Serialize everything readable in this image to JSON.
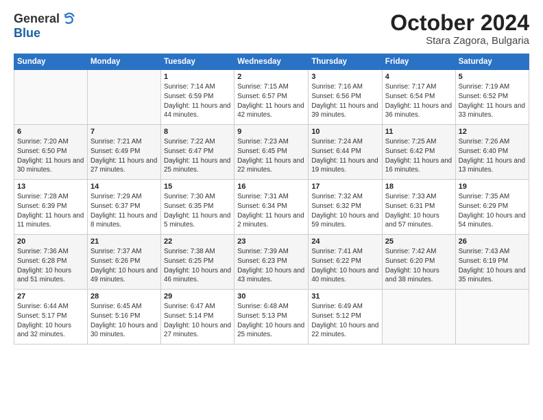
{
  "header": {
    "logo_general": "General",
    "logo_blue": "Blue",
    "month_title": "October 2024",
    "location": "Stara Zagora, Bulgaria"
  },
  "weekdays": [
    "Sunday",
    "Monday",
    "Tuesday",
    "Wednesday",
    "Thursday",
    "Friday",
    "Saturday"
  ],
  "weeks": [
    [
      {
        "day": "",
        "info": ""
      },
      {
        "day": "",
        "info": ""
      },
      {
        "day": "1",
        "info": "Sunrise: 7:14 AM\nSunset: 6:59 PM\nDaylight: 11 hours and 44 minutes."
      },
      {
        "day": "2",
        "info": "Sunrise: 7:15 AM\nSunset: 6:57 PM\nDaylight: 11 hours and 42 minutes."
      },
      {
        "day": "3",
        "info": "Sunrise: 7:16 AM\nSunset: 6:56 PM\nDaylight: 11 hours and 39 minutes."
      },
      {
        "day": "4",
        "info": "Sunrise: 7:17 AM\nSunset: 6:54 PM\nDaylight: 11 hours and 36 minutes."
      },
      {
        "day": "5",
        "info": "Sunrise: 7:19 AM\nSunset: 6:52 PM\nDaylight: 11 hours and 33 minutes."
      }
    ],
    [
      {
        "day": "6",
        "info": "Sunrise: 7:20 AM\nSunset: 6:50 PM\nDaylight: 11 hours and 30 minutes."
      },
      {
        "day": "7",
        "info": "Sunrise: 7:21 AM\nSunset: 6:49 PM\nDaylight: 11 hours and 27 minutes."
      },
      {
        "day": "8",
        "info": "Sunrise: 7:22 AM\nSunset: 6:47 PM\nDaylight: 11 hours and 25 minutes."
      },
      {
        "day": "9",
        "info": "Sunrise: 7:23 AM\nSunset: 6:45 PM\nDaylight: 11 hours and 22 minutes."
      },
      {
        "day": "10",
        "info": "Sunrise: 7:24 AM\nSunset: 6:44 PM\nDaylight: 11 hours and 19 minutes."
      },
      {
        "day": "11",
        "info": "Sunrise: 7:25 AM\nSunset: 6:42 PM\nDaylight: 11 hours and 16 minutes."
      },
      {
        "day": "12",
        "info": "Sunrise: 7:26 AM\nSunset: 6:40 PM\nDaylight: 11 hours and 13 minutes."
      }
    ],
    [
      {
        "day": "13",
        "info": "Sunrise: 7:28 AM\nSunset: 6:39 PM\nDaylight: 11 hours and 11 minutes."
      },
      {
        "day": "14",
        "info": "Sunrise: 7:29 AM\nSunset: 6:37 PM\nDaylight: 11 hours and 8 minutes."
      },
      {
        "day": "15",
        "info": "Sunrise: 7:30 AM\nSunset: 6:35 PM\nDaylight: 11 hours and 5 minutes."
      },
      {
        "day": "16",
        "info": "Sunrise: 7:31 AM\nSunset: 6:34 PM\nDaylight: 11 hours and 2 minutes."
      },
      {
        "day": "17",
        "info": "Sunrise: 7:32 AM\nSunset: 6:32 PM\nDaylight: 10 hours and 59 minutes."
      },
      {
        "day": "18",
        "info": "Sunrise: 7:33 AM\nSunset: 6:31 PM\nDaylight: 10 hours and 57 minutes."
      },
      {
        "day": "19",
        "info": "Sunrise: 7:35 AM\nSunset: 6:29 PM\nDaylight: 10 hours and 54 minutes."
      }
    ],
    [
      {
        "day": "20",
        "info": "Sunrise: 7:36 AM\nSunset: 6:28 PM\nDaylight: 10 hours and 51 minutes."
      },
      {
        "day": "21",
        "info": "Sunrise: 7:37 AM\nSunset: 6:26 PM\nDaylight: 10 hours and 49 minutes."
      },
      {
        "day": "22",
        "info": "Sunrise: 7:38 AM\nSunset: 6:25 PM\nDaylight: 10 hours and 46 minutes."
      },
      {
        "day": "23",
        "info": "Sunrise: 7:39 AM\nSunset: 6:23 PM\nDaylight: 10 hours and 43 minutes."
      },
      {
        "day": "24",
        "info": "Sunrise: 7:41 AM\nSunset: 6:22 PM\nDaylight: 10 hours and 40 minutes."
      },
      {
        "day": "25",
        "info": "Sunrise: 7:42 AM\nSunset: 6:20 PM\nDaylight: 10 hours and 38 minutes."
      },
      {
        "day": "26",
        "info": "Sunrise: 7:43 AM\nSunset: 6:19 PM\nDaylight: 10 hours and 35 minutes."
      }
    ],
    [
      {
        "day": "27",
        "info": "Sunrise: 6:44 AM\nSunset: 5:17 PM\nDaylight: 10 hours and 32 minutes."
      },
      {
        "day": "28",
        "info": "Sunrise: 6:45 AM\nSunset: 5:16 PM\nDaylight: 10 hours and 30 minutes."
      },
      {
        "day": "29",
        "info": "Sunrise: 6:47 AM\nSunset: 5:14 PM\nDaylight: 10 hours and 27 minutes."
      },
      {
        "day": "30",
        "info": "Sunrise: 6:48 AM\nSunset: 5:13 PM\nDaylight: 10 hours and 25 minutes."
      },
      {
        "day": "31",
        "info": "Sunrise: 6:49 AM\nSunset: 5:12 PM\nDaylight: 10 hours and 22 minutes."
      },
      {
        "day": "",
        "info": ""
      },
      {
        "day": "",
        "info": ""
      }
    ]
  ]
}
